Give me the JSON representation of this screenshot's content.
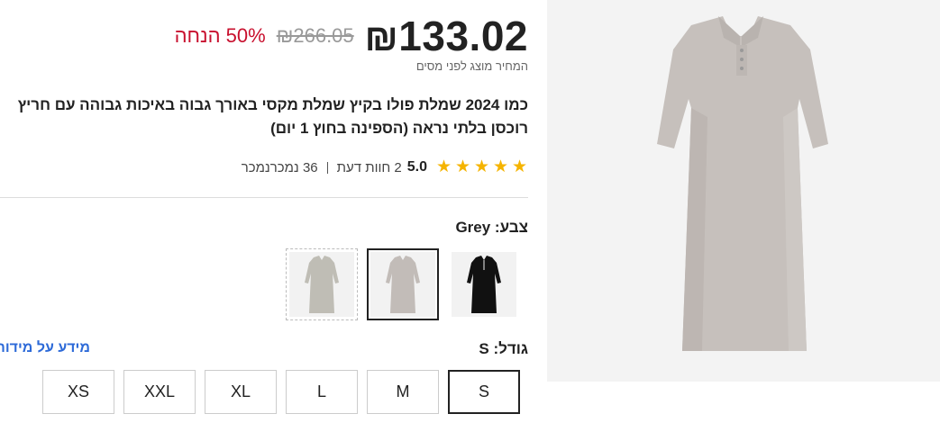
{
  "price": {
    "current": "133.02",
    "currency_symbol": "₪",
    "original": "₪266.05",
    "discount": "50% הנחה",
    "tax_note": "המחיר מוצג לפני מסים"
  },
  "product": {
    "title": "כמו 2024 שמלת פולו בקיץ שמלת מקסי באורך גבוה באיכות גבוהה עם חריץ רוכסן בלתי נראה (הספינה בחוץ 1 יום)"
  },
  "rating": {
    "value": "5.0",
    "stars": 5,
    "reviews": "2 חוות דעת",
    "sold": "36 נמכרנמכר"
  },
  "color": {
    "label": "צבע: Grey",
    "options": [
      {
        "name": "black",
        "color": "#111111"
      },
      {
        "name": "grey",
        "color": "#c2bcb8"
      },
      {
        "name": "light-grey",
        "color": "#bfbdb5"
      }
    ]
  },
  "size": {
    "label": "גודל: S",
    "guide_link": "מידע על מידות",
    "options": [
      "S",
      "M",
      "L",
      "XL",
      "XXL",
      "XS"
    ],
    "selected": "S"
  },
  "colors": {
    "discount_red": "#c8102e",
    "link_blue": "#2d6ad8",
    "star_yellow": "#f5b400",
    "dress_grey": "#c6c0bc"
  }
}
